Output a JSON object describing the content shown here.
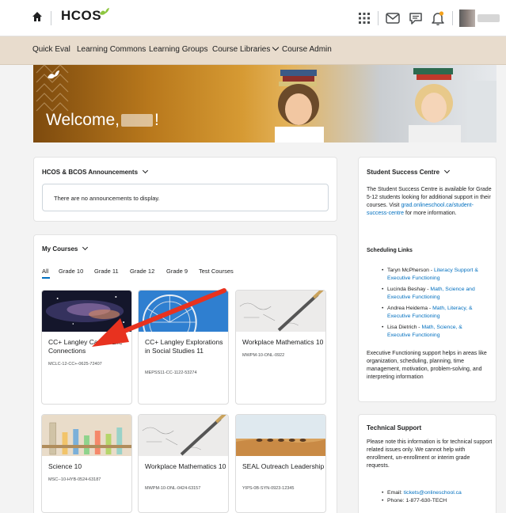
{
  "header": {
    "logo_text": "HCOS",
    "icons": [
      "home-icon",
      "waffle-grid-icon",
      "mail-icon",
      "chat-icon",
      "bell-icon"
    ]
  },
  "nav": {
    "items": [
      {
        "label": "Quick Eval"
      },
      {
        "label": "Learning Commons"
      },
      {
        "label": "Learning Groups"
      },
      {
        "label": "Course Libraries"
      },
      {
        "label": "Course Admin"
      }
    ]
  },
  "banner": {
    "welcome_prefix": "Welcome,",
    "welcome_suffix": "!"
  },
  "announcements": {
    "title": "HCOS & BCOS Announcements",
    "empty_text": "There are no announcements to display."
  },
  "my_courses": {
    "title": "My Courses",
    "tabs": [
      "All",
      "Grade 10",
      "Grade 11",
      "Grade 12",
      "Grade 9",
      "Test Courses"
    ],
    "courses": [
      {
        "name": "CC+ Langley Career Life Connections",
        "code": "MCLC-12-CC+-0625-72407",
        "image": "galaxy"
      },
      {
        "name": "CC+ Langley Explorations in Social Studies 11",
        "code": "MEPSS11-CC-1122-53274",
        "image": "ferris-wheel"
      },
      {
        "name": "Workplace Mathematics 10",
        "code": "MWPM-10-ONL-0922",
        "image": "math-pencil"
      },
      {
        "name": "Science 10",
        "code": "MSC--10-HYB-0524-63187",
        "image": "test-tubes"
      },
      {
        "name": "Workplace Mathematics 10",
        "code": "MWPM-10-ONL-0424-63157",
        "image": "math-pencil"
      },
      {
        "name": "SEAL Outreach Leadership",
        "code": "YIPS-0B-SYN-0923-12345",
        "image": "desert-caravan"
      }
    ]
  },
  "student_success": {
    "title": "Student Success Centre",
    "intro": "The Student Success Centre is available for Grade 5-12 students looking for additional support in their courses.  Visit",
    "link": "grad.onlineschool.ca/student-success-centre",
    "intro_end": "for more information.",
    "scheduling_heading": "Scheduling Links",
    "contacts": [
      {
        "name": "Taryn McPherson",
        "topic": "Literacy Support & Executive Functioning"
      },
      {
        "name": "Lucinda Beshay",
        "topic": "Math, Science and Executive Functioning"
      },
      {
        "name": "Andrea Heidema",
        "topic": "Math, Literacy, & Executive Functioning"
      },
      {
        "name": "Lisa Dietrich",
        "topic": "Math, Science, & Executive Functioning"
      }
    ],
    "outro": "Executive Functioning support helps in areas like organization, scheduling, planning, time management, motivation, problem-solving, and interpreting information"
  },
  "tech_support": {
    "title": "Technical Support",
    "text": "Please note this information is for technical support related issues only. We cannot help with enrollment, un-enrollment or interim grade requests.",
    "email_label": "Email:",
    "email": "tickets@onlineschool.ca",
    "phone_label": "Phone:",
    "phone": "1-877-630-TECH"
  },
  "colors": {
    "nav_bg": "#e8dccd",
    "link": "#006fbf",
    "arrow": "#e8321f",
    "logo_leaf": "#8dc63f"
  }
}
